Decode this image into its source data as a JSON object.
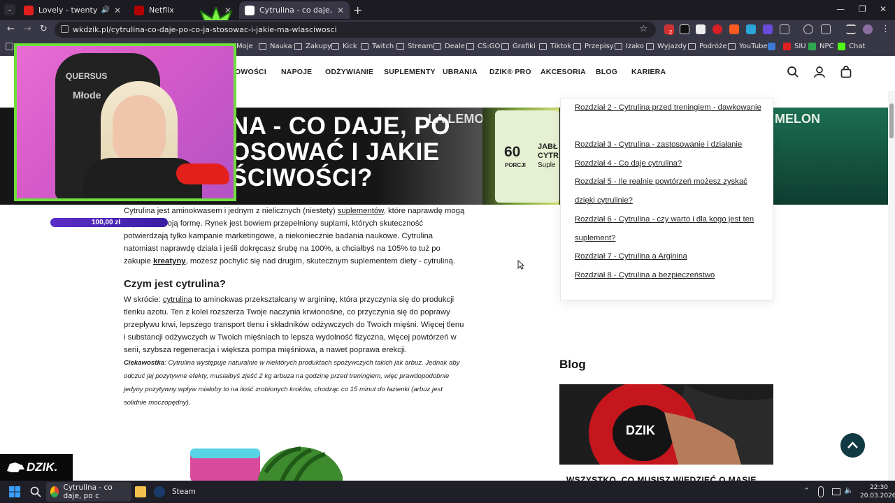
{
  "browser": {
    "tabs": [
      {
        "title": "Lovely - twenty one pilots",
        "fav_color": "#e01f1f"
      },
      {
        "title": "Netflix",
        "fav_color": "#b30000"
      },
      {
        "title": "Cytrulina - co daje, po co ją stos",
        "fav_color": "#333333"
      }
    ],
    "url": "wkdzik.pl/cytrulina-co-daje-po-co-ja-stosowac-i-jakie-ma-wlasciwosci",
    "bookmarks": [
      "Moje",
      "Nauka",
      "Zakupy",
      "Kick",
      "Twitch",
      "Stream",
      "Deale",
      "CS:GO",
      "Grafiki",
      "Tiktok",
      "Przepisy",
      "Izako",
      "Wyjazdy",
      "Podróże",
      "YouTube",
      "SIU",
      "NPC",
      "Chat"
    ],
    "ext_badge": "2"
  },
  "site": {
    "menu": [
      "OWOŚCI",
      "NAPOJE",
      "ODŻYWIANIE",
      "SUPLEMENTY",
      "UBRANIA",
      "DZIK® PRO",
      "AKCESORIA",
      "BLOG",
      "KARIERA"
    ],
    "hero_lines": [
      "NA - CO DAJE, PO",
      "OSOWAĆ I JAKIE",
      "ŚCIWOŚCI?"
    ],
    "hero_can": {
      "number": "60",
      "porcji": "PORCJI",
      "label": "JABŁ",
      "label2": "CYTR",
      "label3": "Suple",
      "lemon": "LA LEMON",
      "melon": "MELON"
    }
  },
  "article": {
    "p1_pre": "Cytrulina jest aminokwasem i jednym z nielicznych (niestety) ",
    "p1_link": "suplementów",
    "p1_post": ", które naprawdę mogą poprawić Twoją formę. Rynek jest bowiem przepełniony suplami, których skuteczność potwierdzają tylko kampanie marketingowe, a niekoniecznie badania naukowe. Cytrulina natomiast naprawdę działa i jeśli dokręcasz śrubę na 100%, a chciałbyś na 105% to tuż po zakupie ",
    "p1_link2": "kreatyny",
    "p1_end": ", możesz pochylić się nad drugim, skutecznym suplementem diety - cytruliną.",
    "h2": "Czym jest cytrulina?",
    "p2_pre": "W skrócie: ",
    "p2_link": "cytrulina",
    "p2_post": " to aminokwas przekształcany w argininę, która przyczynia się do produkcji tlenku azotu. Ten z kolei rozszerza Twoje naczynia krwionośne, co przyczynia się do poprawy przepływu krwi, lepszego transport tlenu i składników odżywczych do Twoich mięśni. Więcej tlenu i substancji odżywczych w Twoich mięśniach to lepsza wydolność fizyczna, więcej powtórzeń w serii, szybsza regeneracja i większa pompa mięśniowa, a nawet poprawa erekcji.",
    "trivia_label": "Ciekawostka",
    "trivia_text": ": Cytrulina występuje naturalnie w niektórych produktach spożywczych takich jak arbuz. Jednak aby odczuć jej pozytywne efekty, musiałbyś zjeść 2 kg arbuza na godzinę przed treningiem, więc prawdopodobnie jedyny pozytywny wpływ miałoby to na ilość zrobionych kroków, chodząc co 15 minut do łazienki (arbuz jest solidnie moczopędny)."
  },
  "toc": [
    "Rozdział 2 - Cytrulina przed treningiem - dawkowanie",
    "Rozdział 3 - Cytrulina - zastosowanie i działanie",
    "Rozdział 4 - Co daje cytrulina?",
    "Rozdział 5 - Ile realnie powtórzeń możesz zyskać dzięki cytrulinie?",
    "Rozdział 6 - Cytrulina - czy warto i dla kogo jest ten suplement?",
    "Rozdział 7 - Cytrulina a Arginina",
    "Rozdział 8 - Cytrulina a bezpieczeństwo"
  ],
  "blog": {
    "heading": "Blog",
    "card_title": "WSZYSTKO, CO MUSISZ WIEDZIEĆ O MASIE",
    "card_brand": "DZIK"
  },
  "overlay": {
    "goal": "100,00 zł",
    "cam_brand": "QUERSUS",
    "cam_brand2": "Młode",
    "badge": "DZIK."
  },
  "taskbar": {
    "app": "Cytrulina - co daje, po c",
    "steam": "Steam",
    "time": "22:30",
    "date": "20.03.2026"
  }
}
